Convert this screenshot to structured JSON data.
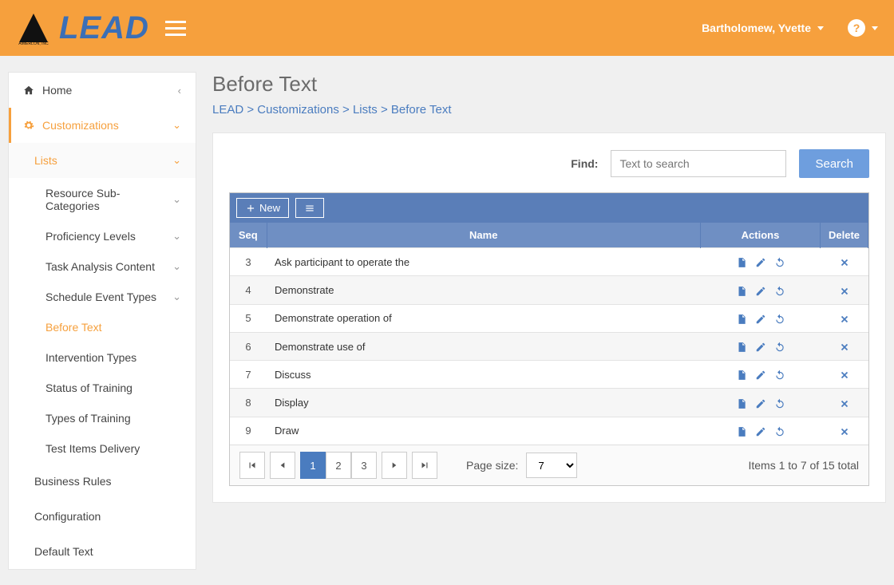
{
  "header": {
    "brand_text": "LEAD",
    "user_name": "Bartholomew, Yvette"
  },
  "sidebar": {
    "home": "Home",
    "customizations": "Customizations",
    "lists": "Lists",
    "list_items": [
      "Resource Sub-Categories",
      "Proficiency Levels",
      "Task Analysis Content",
      "Schedule Event Types",
      "Before Text",
      "Intervention Types",
      "Status of Training",
      "Types of Training",
      "Test Items Delivery"
    ],
    "business_rules": "Business Rules",
    "configuration": "Configuration",
    "default_text": "Default Text"
  },
  "page": {
    "title": "Before Text",
    "breadcrumb": {
      "a": "LEAD",
      "b": "Customizations",
      "c": "Lists",
      "d": "Before Text",
      "sep": " > "
    }
  },
  "search": {
    "label": "Find:",
    "placeholder": "Text to search",
    "button": "Search"
  },
  "toolbar": {
    "new_label": "New"
  },
  "table": {
    "columns": {
      "seq": "Seq",
      "name": "Name",
      "actions": "Actions",
      "delete": "Delete"
    },
    "rows": [
      {
        "seq": "3",
        "name": "Ask participant to operate the"
      },
      {
        "seq": "4",
        "name": "Demonstrate"
      },
      {
        "seq": "5",
        "name": "Demonstrate operation of"
      },
      {
        "seq": "6",
        "name": "Demonstrate use of"
      },
      {
        "seq": "7",
        "name": "Discuss"
      },
      {
        "seq": "8",
        "name": "Display"
      },
      {
        "seq": "9",
        "name": "Draw"
      }
    ]
  },
  "pager": {
    "pages": [
      "1",
      "2",
      "3"
    ],
    "active": "1",
    "page_size_label": "Page size:",
    "page_size_value": "7",
    "info": "Items 1 to 7 of 15 total"
  }
}
